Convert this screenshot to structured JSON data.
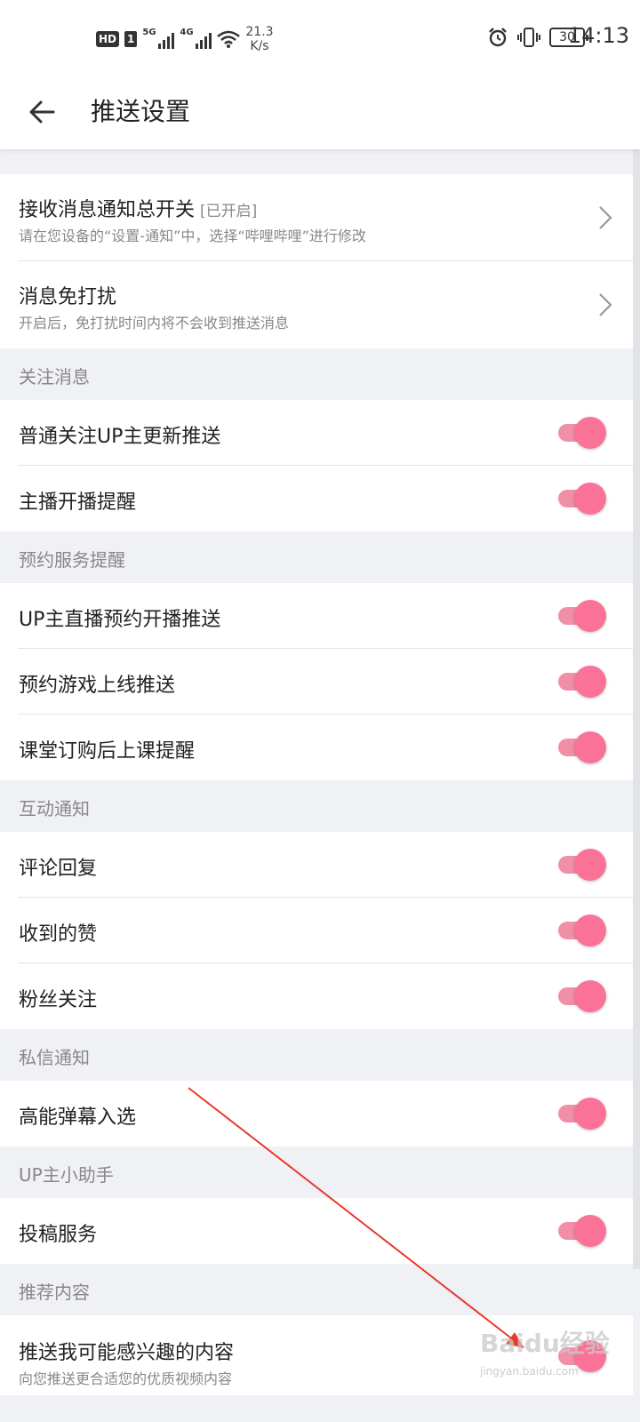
{
  "status_bar": {
    "hd": "HD",
    "sim": "1",
    "net1": "5G",
    "net2": "4G",
    "speed_value": "21.3",
    "speed_unit": "K/s",
    "battery": "30",
    "time": "14:13"
  },
  "header": {
    "title": "推送设置"
  },
  "items": {
    "master": {
      "label": "接收消息通知总开关",
      "badge": "[已开启]",
      "sub": "请在您设备的“设置-通知”中，选择“哔哩哔哩”进行修改"
    },
    "dnd": {
      "label": "消息免打扰",
      "sub": "开启后，免打扰时间内将不会收到推送消息"
    }
  },
  "sections": {
    "follow": {
      "title": "关注消息",
      "rows": [
        {
          "label": "普通关注UP主更新推送",
          "on": true
        },
        {
          "label": "主播开播提醒",
          "on": true
        }
      ]
    },
    "booking": {
      "title": "预约服务提醒",
      "rows": [
        {
          "label": "UP主直播预约开播推送",
          "on": true
        },
        {
          "label": "预约游戏上线推送",
          "on": true
        },
        {
          "label": "课堂订购后上课提醒",
          "on": true
        }
      ]
    },
    "interact": {
      "title": "互动通知",
      "rows": [
        {
          "label": "评论回复",
          "on": true
        },
        {
          "label": "收到的赞",
          "on": true
        },
        {
          "label": "粉丝关注",
          "on": true
        }
      ]
    },
    "dm": {
      "title": "私信通知",
      "rows": [
        {
          "label": "高能弹幕入选",
          "on": true
        }
      ]
    },
    "helper": {
      "title": "UP主小助手",
      "rows": [
        {
          "label": "投稿服务",
          "on": true
        }
      ]
    },
    "recommend": {
      "title": "推荐内容",
      "rows": [
        {
          "label": "推送我可能感兴趣的内容",
          "sub": "向您推送更合适您的优质视频内容",
          "on": true
        }
      ]
    }
  },
  "watermark": {
    "brand": "Baidu经验",
    "url": "jingyan.baidu.com"
  },
  "colors": {
    "accent": "#fb7299",
    "track": "#f28fa8",
    "annotation_arrow": "#e8392c"
  }
}
